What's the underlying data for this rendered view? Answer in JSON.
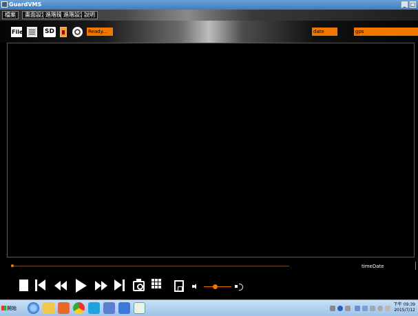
{
  "window": {
    "title": "GuardVMS"
  },
  "menu": {
    "items": [
      "檔案",
      "畫面設定",
      "進階操作",
      "進階設定",
      "說明"
    ]
  },
  "toolbar": {
    "file_label": "File",
    "sd_label": "SD",
    "status_text": "Ready...",
    "date_text": "date",
    "gps_text": "gps"
  },
  "playback": {
    "time_date_label": "timeDate",
    "volume_level": 0.4
  },
  "taskbar": {
    "start_label": "開始",
    "clock_time": "下午 09:39",
    "clock_date": "2015/7/12"
  },
  "colors": {
    "accent": "#f07800",
    "video_bg": "#000000"
  }
}
